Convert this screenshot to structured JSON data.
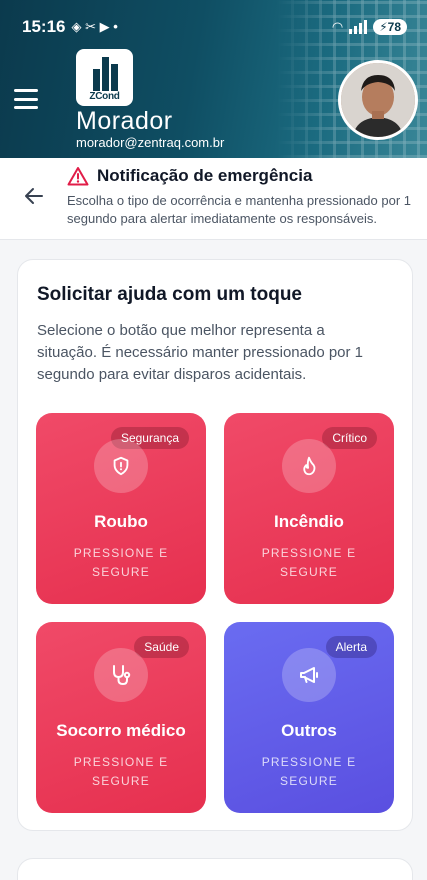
{
  "status_bar": {
    "time": "15:16",
    "battery": "78"
  },
  "header": {
    "logo_text": "ZCond",
    "user_name": "Morador",
    "user_email": "morador@zentraq.com.br"
  },
  "subheader": {
    "title": "Notificação de emergência",
    "description": "Escolha o tipo de ocorrência e mantenha pressionado por 1 segundo para alertar imediatamente os responsáveis."
  },
  "card": {
    "title": "Solicitar ajuda com um toque",
    "description": "Selecione o botão que melhor representa a situação. É necessário manter pressionado por 1 segundo para evitar disparos acidentais."
  },
  "tiles": [
    {
      "label": "Roubo",
      "badge": "Segurança",
      "hint": "PRESSIONE E SEGURE",
      "icon": "shield-alert-icon",
      "color": "#eb3b5a"
    },
    {
      "label": "Incêndio",
      "badge": "Crítico",
      "hint": "PRESSIONE E SEGURE",
      "icon": "flame-icon",
      "color": "#eb3b5a"
    },
    {
      "label": "Socorro médico",
      "badge": "Saúde",
      "hint": "PRESSIONE E SEGURE",
      "icon": "stethoscope-icon",
      "color": "#eb3b5a"
    },
    {
      "label": "Outros",
      "badge": "Alerta",
      "hint": "PRESSIONE E SEGURE",
      "icon": "megaphone-icon",
      "color": "#6366f1"
    }
  ]
}
